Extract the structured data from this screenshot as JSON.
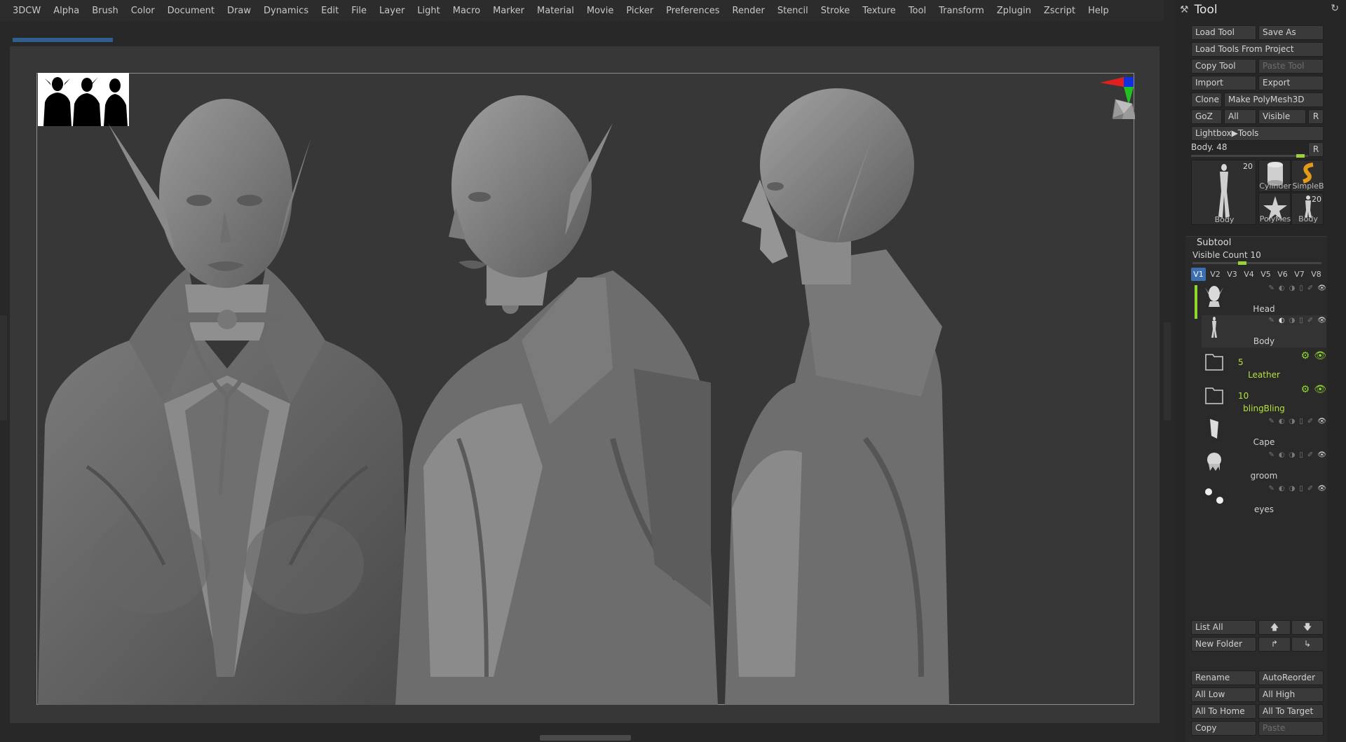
{
  "menubar": {
    "items": [
      "3DCW",
      "Alpha",
      "Brush",
      "Color",
      "Document",
      "Draw",
      "Dynamics",
      "Edit",
      "File",
      "Layer",
      "Light",
      "Macro",
      "Marker",
      "Material",
      "Movie",
      "Picker",
      "Preferences",
      "Render",
      "Stencil",
      "Stroke",
      "Texture",
      "Tool",
      "Transform",
      "Zplugin",
      "Zscript",
      "Help"
    ]
  },
  "tool_panel": {
    "title": "Tool",
    "buttons": {
      "load_tool": "Load Tool",
      "save_as": "Save As",
      "load_tools_from_project": "Load Tools From Project",
      "copy_tool": "Copy Tool",
      "paste_tool": "Paste Tool",
      "import": "Import",
      "export": "Export",
      "clone": "Clone",
      "make_polymesh3d": "Make PolyMesh3D",
      "goz": "GoZ",
      "all": "All",
      "visible": "Visible",
      "r": "R",
      "lightbox_tools": "Lightbox▶Tools"
    },
    "current_tool": {
      "label": "Body",
      "value": "48",
      "r_button": "R"
    },
    "thumbnails": [
      {
        "label": "Body",
        "badge": "20"
      },
      {
        "label": "Cylinder",
        "badge": ""
      },
      {
        "label": "SimpleB",
        "badge": ""
      },
      {
        "label": "PolyMes",
        "badge": ""
      },
      {
        "label": "Body",
        "badge": "20"
      }
    ]
  },
  "subtool": {
    "title": "Subtool",
    "visible_count_label": "Visible Count",
    "visible_count_value": "10",
    "tabs": [
      "V1",
      "V2",
      "V3",
      "V4",
      "V5",
      "V6",
      "V7",
      "V8"
    ],
    "active_tab": "V1",
    "items": [
      {
        "name": "Head",
        "type": "mesh",
        "count": ""
      },
      {
        "name": "Body",
        "type": "mesh",
        "count": ""
      },
      {
        "name": "Leather",
        "type": "folder",
        "count": "5"
      },
      {
        "name": "blingBling",
        "type": "folder",
        "count": "10"
      },
      {
        "name": "Cape",
        "type": "mesh",
        "count": ""
      },
      {
        "name": "groom",
        "type": "mesh",
        "count": ""
      },
      {
        "name": "eyes",
        "type": "mesh",
        "count": ""
      }
    ],
    "buttons": {
      "list_all": "List All",
      "new_folder": "New Folder",
      "rename": "Rename",
      "autoreorder": "AutoReorder",
      "all_low": "All Low",
      "all_high": "All High",
      "all_to_home": "All To Home",
      "all_to_target": "All To Target",
      "copy": "Copy",
      "paste": "Paste"
    }
  },
  "colors": {
    "accent_green": "#8fd72b",
    "active_tab_blue": "#3b6fb0",
    "viewport_bg": "#373737"
  }
}
